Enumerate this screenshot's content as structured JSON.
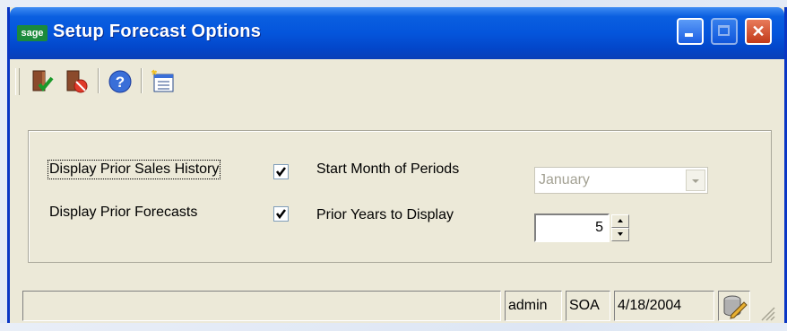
{
  "window": {
    "logo_text": "sage",
    "title": "Setup Forecast Options"
  },
  "toolbar": {
    "buttons": [
      {
        "name": "accept",
        "icon": "accept-door-icon"
      },
      {
        "name": "cancel",
        "icon": "cancel-door-icon"
      },
      {
        "name": "help",
        "icon": "help-icon"
      },
      {
        "name": "setup",
        "icon": "setup-icon"
      }
    ]
  },
  "form": {
    "display_prior_sales_history": {
      "label": "Display Prior Sales History",
      "checked": true
    },
    "display_prior_forecasts": {
      "label": "Display Prior Forecasts",
      "checked": true
    },
    "start_month": {
      "label": "Start Month of Periods",
      "value": "January",
      "enabled": false
    },
    "prior_years": {
      "label": "Prior Years to Display",
      "value": "5"
    }
  },
  "status": {
    "user": "admin",
    "company": "SOA",
    "date": "4/18/2004"
  },
  "colors": {
    "title_bar": "#0455dc",
    "window_bg": "#ece9d8",
    "close_button": "#c23a1a"
  }
}
